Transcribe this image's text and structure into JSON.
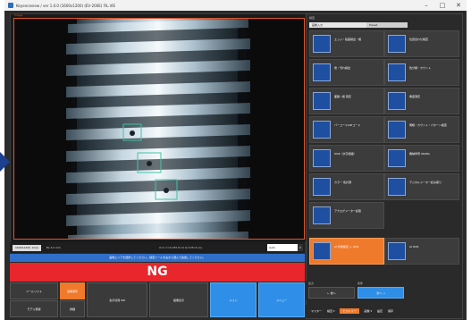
{
  "window": {
    "title": "Keyenceview / ver 1.0.0 (1600x1200) (EV‑200E) FIL.VIE",
    "min_glyph": "–",
    "max_glyph": "□",
    "close_glyph": "✕"
  },
  "viewer": {
    "label": "Image",
    "statusbar": {
      "cell1": "1600x1200 .bmp",
      "cell2": "BL 4.0 mm",
      "coords": "X=1   Y=0   255   R=0 G=0 B=0  (1)",
      "zoom": "Auto"
    }
  },
  "infobar": "画像エリアを選択してください。検査ツールを右から選んで追加してください。",
  "judgement": "NG",
  "bottom_buttons": {
    "b1": "ツールリスト",
    "b2": "画像保存",
    "b3": "モデル登録",
    "b4": "詳細",
    "b5": "表示切替 ON",
    "b6": "結果表示",
    "b7": "メイン",
    "b8": "メニュー"
  },
  "rpanel": {
    "header": "検査",
    "tab1": "画像入力",
    "tab2": "Preset",
    "tools": [
      {
        "label": "エッジ・段差検出・幅"
      },
      {
        "label": "位置合わせ検査"
      },
      {
        "label": "傷・汚れ検出"
      },
      {
        "label": "色分類・カウント"
      },
      {
        "label": "面積 / 幅 測定"
      },
      {
        "label": "角度測定"
      },
      {
        "label": "バーコード/2Dコード"
      },
      {
        "label": "明暗・カウント・パターン検査"
      },
      {
        "label": "OCR（文字認識）"
      },
      {
        "label": "機械学習 OK/NG"
      },
      {
        "label": "カラー 色計測"
      },
      {
        "label": "デジタルメーター読み取り"
      },
      {
        "label": "アナログメーター読取"
      },
      {
        "label": ""
      },
      {
        "label": "AI 外観検査 ＋ OCR"
      },
      {
        "label": "AI OCR"
      }
    ],
    "foot1": {
      "cap1": "出力",
      "cap2": "条件",
      "btn1": "← 前へ",
      "btn2": "次へ →"
    },
    "foot2": {
      "i1": "マスター",
      "i2": "検査 ▾",
      "i3": "ヒストリー",
      "i4": "画像 ▾",
      "i5": "設定",
      "i6": "保存"
    }
  },
  "colors": {
    "accent_orange": "#f07a2b",
    "ng_red": "#e8262b",
    "info_blue": "#2f6fc9",
    "frame_orange": "#e0542a"
  }
}
